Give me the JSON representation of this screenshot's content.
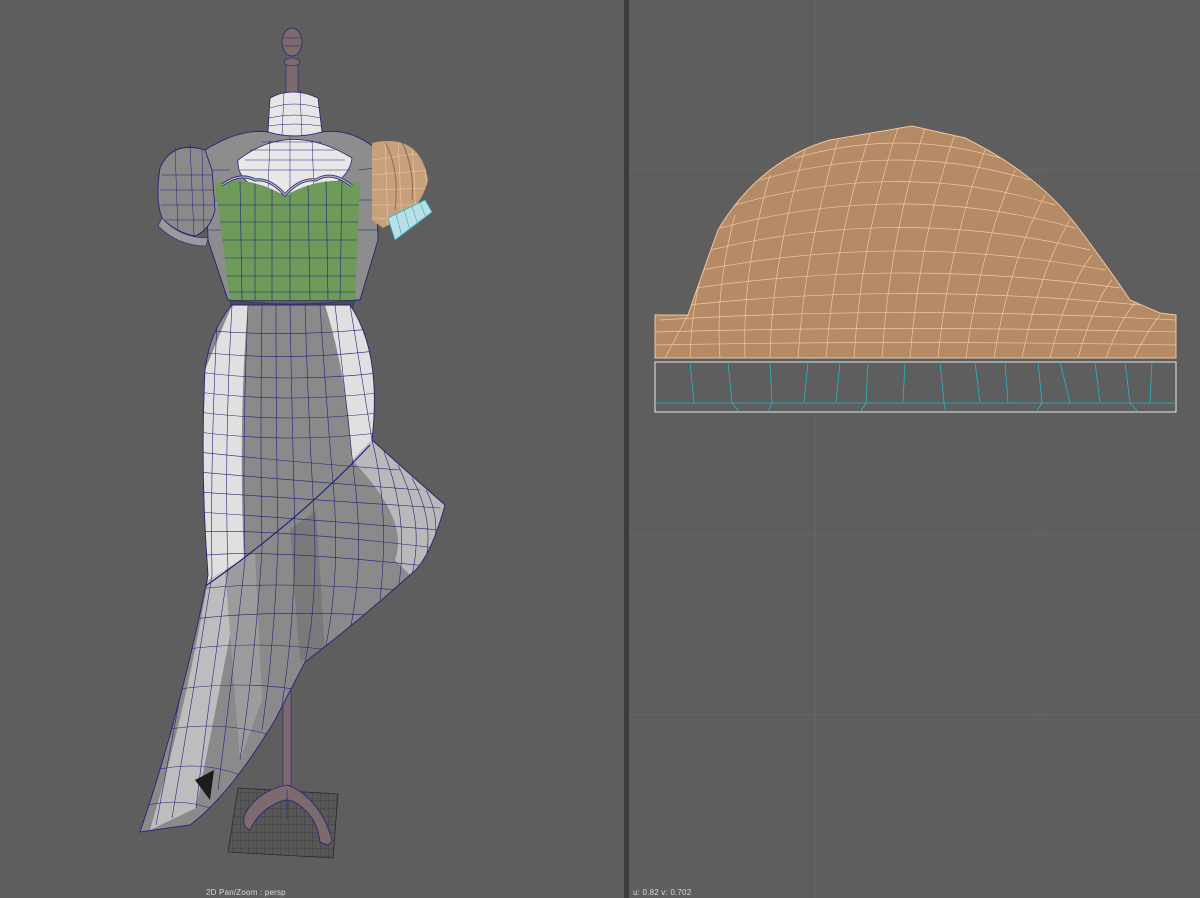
{
  "left_viewport": {
    "label": "2D Pan/Zoom : persp",
    "object": "dress-on-mannequin",
    "colors": {
      "background": "#5e5e5e",
      "dress_light": "#d9d9d9",
      "dress_dark": "#8a8a8a",
      "bodice_green": "#6e9a5a",
      "wire": "#23237a",
      "selected_sleeve": "#c7a07c",
      "mannequin": "#7d6a6e",
      "floor_grid": "#2a2a2a"
    }
  },
  "right_viewport": {
    "label": "u: 0.82 v: 0.702",
    "object": "uv-shell-sleeve",
    "colors": {
      "background": "#5e5e5e",
      "selected_shell": "#b58a66",
      "selected_wire": "#f4c69a",
      "cuff_wire": "#28b5c8",
      "cuff_border": "#e8e8e8",
      "grid": "#6a6a6a"
    }
  }
}
